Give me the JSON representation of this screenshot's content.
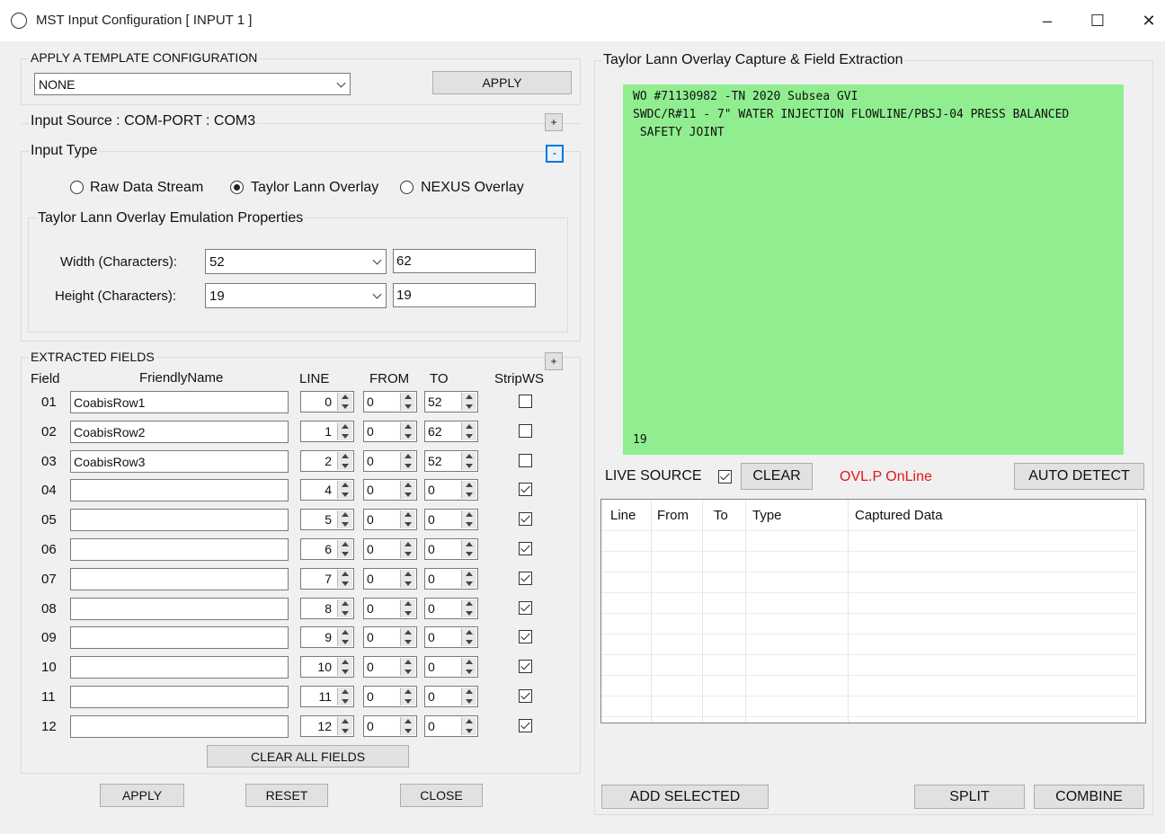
{
  "window": {
    "title": "MST Input Configuration [ INPUT 1 ]",
    "minimize": "–",
    "maximize": "☐",
    "close": "✕"
  },
  "template": {
    "group_label": "APPLY A TEMPLATE CONFIGURATION",
    "selected": "NONE",
    "apply_label": "APPLY"
  },
  "input_source": {
    "label": "Input Source : COM-PORT : COM3",
    "expand": "+"
  },
  "input_type": {
    "label": "Input Type",
    "collapse": "-",
    "options": [
      {
        "label": "Raw Data Stream",
        "selected": false
      },
      {
        "label": "Taylor Lann Overlay",
        "selected": true
      },
      {
        "label": "NEXUS Overlay",
        "selected": false
      }
    ]
  },
  "emulation": {
    "label": "Taylor Lann Overlay Emulation Properties",
    "width_label": "Width (Characters):",
    "width_value": "52",
    "width_alt": "62",
    "height_label": "Height (Characters):",
    "height_value": "19",
    "height_alt": "19"
  },
  "fields": {
    "label": "EXTRACTED FIELDS",
    "expand": "+",
    "headers": {
      "field": "Field",
      "name": "FriendlyName",
      "line": "LINE",
      "from": "FROM",
      "to": "TO",
      "strip": "StripWS"
    },
    "rows": [
      {
        "id": "01",
        "name": "CoabisRow1",
        "line": "0",
        "from": "0",
        "to": "52",
        "strip": false
      },
      {
        "id": "02",
        "name": "CoabisRow2",
        "line": "1",
        "from": "0",
        "to": "62",
        "strip": false
      },
      {
        "id": "03",
        "name": "CoabisRow3",
        "line": "2",
        "from": "0",
        "to": "52",
        "strip": false
      },
      {
        "id": "04",
        "name": "",
        "line": "4",
        "from": "0",
        "to": "0",
        "strip": true
      },
      {
        "id": "05",
        "name": "",
        "line": "5",
        "from": "0",
        "to": "0",
        "strip": true
      },
      {
        "id": "06",
        "name": "",
        "line": "6",
        "from": "0",
        "to": "0",
        "strip": true
      },
      {
        "id": "07",
        "name": "",
        "line": "7",
        "from": "0",
        "to": "0",
        "strip": true
      },
      {
        "id": "08",
        "name": "",
        "line": "8",
        "from": "0",
        "to": "0",
        "strip": true
      },
      {
        "id": "09",
        "name": "",
        "line": "9",
        "from": "0",
        "to": "0",
        "strip": true
      },
      {
        "id": "10",
        "name": "",
        "line": "10",
        "from": "0",
        "to": "0",
        "strip": true
      },
      {
        "id": "11",
        "name": "",
        "line": "11",
        "from": "0",
        "to": "0",
        "strip": true
      },
      {
        "id": "12",
        "name": "",
        "line": "12",
        "from": "0",
        "to": "0",
        "strip": true
      }
    ],
    "clear_all_label": "CLEAR ALL FIELDS"
  },
  "footer": {
    "apply": "APPLY",
    "reset": "RESET",
    "close": "CLOSE"
  },
  "capture": {
    "label": "Taylor Lann Overlay Capture & Field Extraction",
    "overlay_lines": [
      "WO #71130982 -TN 2020 Subsea GVI",
      "SWDC/R#11 - 7\" WATER INJECTION FLOWLINE/PBSJ-04 PRESS BALANCED",
      " SAFETY JOINT"
    ],
    "overlay_footer": "19",
    "overlay_color": "#90ee90",
    "live_source_label": "LIVE SOURCE",
    "live_source_checked": true,
    "clear_label": "CLEAR",
    "status": "OVL.P OnLine",
    "status_color": "#e01818",
    "auto_detect_label": "AUTO DETECT",
    "grid_headers": [
      "Line",
      "From",
      "To",
      "Type",
      "Captured Data"
    ],
    "add_selected_label": "ADD SELECTED",
    "split_label": "SPLIT",
    "combine_label": "COMBINE"
  }
}
